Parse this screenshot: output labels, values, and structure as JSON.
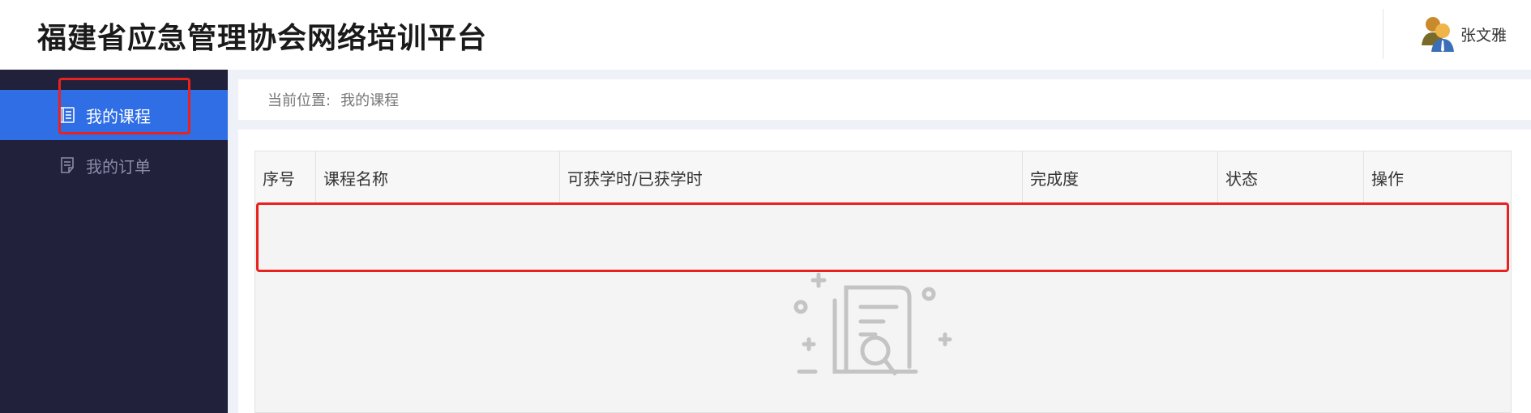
{
  "header": {
    "app_title": "福建省应急管理协会网络培训平台",
    "user_name": "张文雅"
  },
  "sidebar": {
    "items": [
      {
        "label": "我的课程",
        "icon": "course-list-icon",
        "active": true
      },
      {
        "label": "我的订单",
        "icon": "order-doc-icon",
        "active": false
      }
    ]
  },
  "breadcrumb": {
    "prefix": "当前位置:",
    "current": "我的课程"
  },
  "table": {
    "columns": [
      "序号",
      "课程名称",
      "可获学时/已获学时",
      "完成度",
      "状态",
      "操作"
    ],
    "rows": []
  },
  "empty_state": {
    "icon": "empty-document-icon"
  },
  "colors": {
    "sidebar_bg": "#21213b",
    "active_item": "#2f6ee5",
    "highlight": "#e8231f",
    "page_bg": "#eef2f8"
  }
}
